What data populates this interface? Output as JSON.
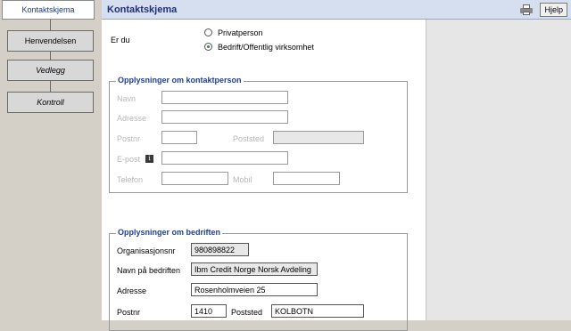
{
  "steps": {
    "kontaktskjema": "Kontaktskjema",
    "henvendelsen": "Henvendelsen",
    "vedlegg": "Vedlegg",
    "kontroll": "Kontroll"
  },
  "header": {
    "title": "Kontaktskjema",
    "help_label": "Hjelp"
  },
  "er_du": {
    "label": "Er du",
    "options": [
      "Privatperson",
      "Bedrift/Offentlig virksomhet"
    ],
    "selected": "Bedrift/Offentlig virksomhet"
  },
  "kontaktperson": {
    "legend": "Opplysninger om kontaktperson",
    "navn": "Navn",
    "adresse": "Adresse",
    "postnr": "Postnr",
    "poststed": "Poststed",
    "epost": "E-post",
    "telefon": "Telefon",
    "mobil": "Mobil"
  },
  "bedrift": {
    "legend": "Opplysninger om bedriften",
    "orgnr_label": "Organisasjonsnr",
    "orgnr_value": "980898822",
    "navn_label": "Navn på bedriften",
    "navn_value": "Ibm Credit Norge Norsk Avdeling",
    "adresse_label": "Adresse",
    "adresse_value": "Rosenholmveien 25",
    "postnr_label": "Postnr",
    "postnr_value": "1410",
    "poststed_label": "Poststed",
    "poststed_value": "KOLBOTN"
  }
}
